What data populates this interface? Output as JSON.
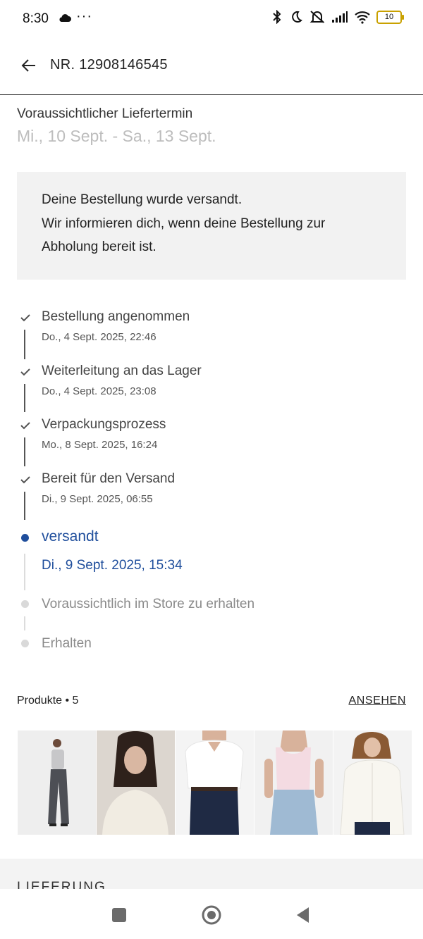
{
  "status_bar": {
    "time": "8:30",
    "battery": "10",
    "icons": [
      "cloud-icon",
      "more-dots-icon",
      "bluetooth-icon",
      "moon-icon",
      "mute-icon",
      "signal-icon",
      "wifi-icon",
      "battery-icon"
    ]
  },
  "header": {
    "title": "NR. 12908146545",
    "back_icon": "arrow-left-icon"
  },
  "delivery": {
    "label": "Voraussichtlicher Liefertermin",
    "date_range": "Mi., 10 Sept. - Sa., 13 Sept."
  },
  "notice": {
    "line1": "Deine Bestellung wurde versandt.",
    "line2": "Wir informieren dich, wenn deine Bestellung zur",
    "line3": "Abholung bereit ist."
  },
  "timeline": {
    "steps": [
      {
        "label": "Bestellung angenommen",
        "date": "Do., 4 Sept. 2025, 22:46",
        "state": "done"
      },
      {
        "label": "Weiterleitung an das Lager",
        "date": "Do., 4 Sept. 2025, 23:08",
        "state": "done"
      },
      {
        "label": "Verpackungsprozess",
        "date": "Mo., 8 Sept. 2025, 16:24",
        "state": "done"
      },
      {
        "label": "Bereit für den Versand",
        "date": "Di., 9 Sept. 2025, 06:55",
        "state": "done"
      },
      {
        "label": "versandt",
        "date": "Di., 9 Sept. 2025, 15:34",
        "state": "current"
      },
      {
        "label": "Voraussichtlich im Store zu erhalten",
        "state": "pending"
      },
      {
        "label": "Erhalten",
        "state": "pending"
      }
    ]
  },
  "products": {
    "label": "Produkte • 5",
    "link": "ANSEHEN",
    "items": [
      "product-1",
      "product-2",
      "product-3",
      "product-4",
      "product-5"
    ]
  },
  "next_section": {
    "label": "LIEFERUNG"
  },
  "colors": {
    "accent_blue": "#1f4e9c",
    "pending_gray": "#d9d9d9",
    "notice_bg": "#f2f2f2",
    "date_gray": "#bdbdbd"
  }
}
